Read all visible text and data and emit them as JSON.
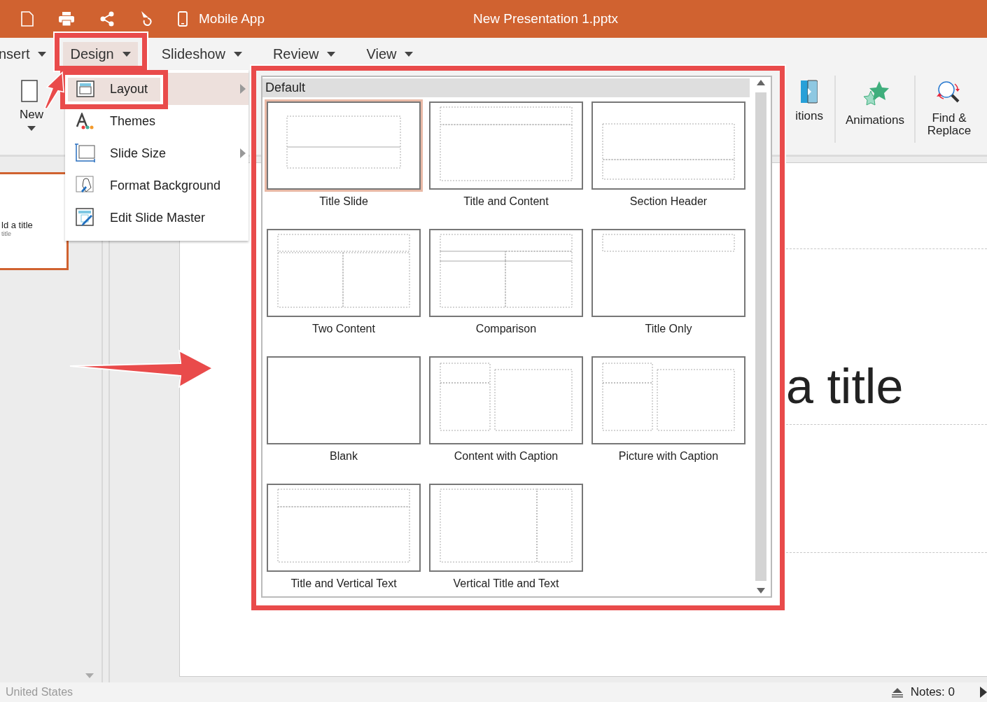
{
  "title_bar": {
    "app_label": "Mobile App",
    "title": "New Presentation 1.pptx"
  },
  "menu_tabs": [
    {
      "label": "nsert",
      "selected": false
    },
    {
      "label": "Design",
      "selected": true
    },
    {
      "label": "Slideshow",
      "selected": false
    },
    {
      "label": "Review",
      "selected": false
    },
    {
      "label": "View",
      "selected": false
    }
  ],
  "ribbon": {
    "new_label": "New",
    "buttons": [
      {
        "label": "itions"
      },
      {
        "label": "Animations"
      },
      {
        "label": "Find & Replace"
      }
    ]
  },
  "thumbnail": {
    "title": "ld a title",
    "subtitle": "title"
  },
  "slide": {
    "title": "a title"
  },
  "design_menu": [
    {
      "label": "Layout",
      "selected": true,
      "has_submenu": true
    },
    {
      "label": "Themes",
      "selected": false,
      "has_submenu": false
    },
    {
      "label": "Slide Size",
      "selected": false,
      "has_submenu": true
    },
    {
      "label": "Format Background",
      "selected": false,
      "has_submenu": false
    },
    {
      "label": "Edit Slide Master",
      "selected": false,
      "has_submenu": false
    }
  ],
  "layout_gallery": {
    "group": "Default",
    "layouts": [
      {
        "label": "Title Slide",
        "kind": "title_slide",
        "selected": true
      },
      {
        "label": "Title and Content",
        "kind": "title_content",
        "selected": false
      },
      {
        "label": "Section Header",
        "kind": "section_header",
        "selected": false
      },
      {
        "label": "Two Content",
        "kind": "two_content",
        "selected": false
      },
      {
        "label": "Comparison",
        "kind": "comparison",
        "selected": false
      },
      {
        "label": "Title Only",
        "kind": "title_only",
        "selected": false
      },
      {
        "label": "Blank",
        "kind": "blank",
        "selected": false
      },
      {
        "label": "Content with Caption",
        "kind": "content_caption",
        "selected": false
      },
      {
        "label": "Picture with Caption",
        "kind": "picture_caption",
        "selected": false
      },
      {
        "label": "Title and Vertical Text",
        "kind": "title_vertical_text",
        "selected": false
      },
      {
        "label": "Vertical Title and Text",
        "kind": "vertical_title_text",
        "selected": false
      }
    ]
  },
  "status_bar": {
    "language": "United States",
    "notes": "Notes: 0"
  }
}
